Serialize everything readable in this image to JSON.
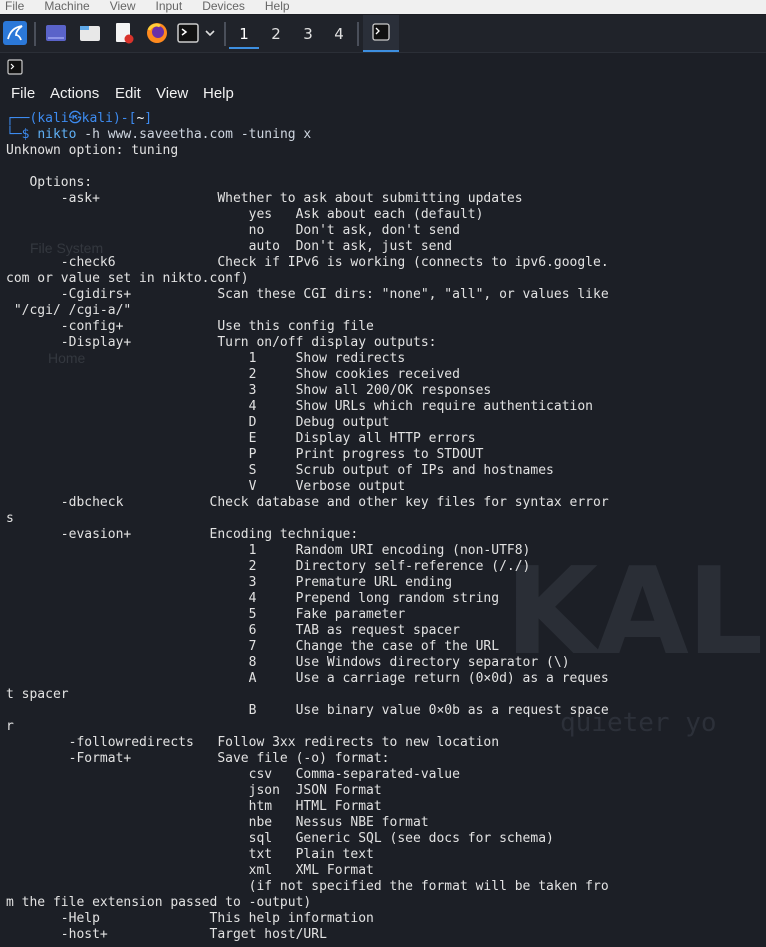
{
  "vm_menu": [
    "File",
    "Machine",
    "View",
    "Input",
    "Devices",
    "Help"
  ],
  "panel": {
    "workspaces": [
      "1",
      "2",
      "3",
      "4"
    ],
    "active_workspace": "1"
  },
  "desktop": {
    "watermark": "KAL",
    "watermark_tagline": "quieter yo",
    "icons": [
      "File System",
      "Home"
    ]
  },
  "terminal": {
    "menu": [
      "File",
      "Actions",
      "Edit",
      "View",
      "Help"
    ],
    "prompt": {
      "user": "kali",
      "host": "kali",
      "cwd": "~",
      "command": "nikto",
      "args": "-h www.saveetha.com -tuning x"
    },
    "output_lines": [
      "Unknown option: tuning",
      "",
      "   Options:",
      "       -ask+               Whether to ask about submitting updates",
      "                               yes   Ask about each (default)",
      "                               no    Don't ask, don't send",
      "                               auto  Don't ask, just send",
      "       -check6             Check if IPv6 is working (connects to ipv6.google.",
      "com or value set in nikto.conf)",
      "       -Cgidirs+           Scan these CGI dirs: \"none\", \"all\", or values like",
      " \"/cgi/ /cgi-a/\"",
      "       -config+            Use this config file",
      "       -Display+           Turn on/off display outputs:",
      "                               1     Show redirects",
      "                               2     Show cookies received",
      "                               3     Show all 200/OK responses",
      "                               4     Show URLs which require authentication",
      "                               D     Debug output",
      "                               E     Display all HTTP errors",
      "                               P     Print progress to STDOUT",
      "                               S     Scrub output of IPs and hostnames",
      "                               V     Verbose output",
      "       -dbcheck           Check database and other key files for syntax error",
      "s",
      "       -evasion+          Encoding technique:",
      "                               1     Random URI encoding (non-UTF8)",
      "                               2     Directory self-reference (/./)",
      "                               3     Premature URL ending",
      "                               4     Prepend long random string",
      "                               5     Fake parameter",
      "                               6     TAB as request spacer",
      "                               7     Change the case of the URL",
      "                               8     Use Windows directory separator (\\)",
      "                               A     Use a carriage return (0×0d) as a reques",
      "t spacer",
      "                               B     Use binary value 0×0b as a request space",
      "r",
      "        -followredirects   Follow 3xx redirects to new location",
      "        -Format+           Save file (-o) format:",
      "                               csv   Comma-separated-value",
      "                               json  JSON Format",
      "                               htm   HTML Format",
      "                               nbe   Nessus NBE format",
      "                               sql   Generic SQL (see docs for schema)",
      "                               txt   Plain text",
      "                               xml   XML Format",
      "                               (if not specified the format will be taken fro",
      "m the file extension passed to -output)",
      "       -Help              This help information",
      "       -host+             Target host/URL"
    ]
  }
}
